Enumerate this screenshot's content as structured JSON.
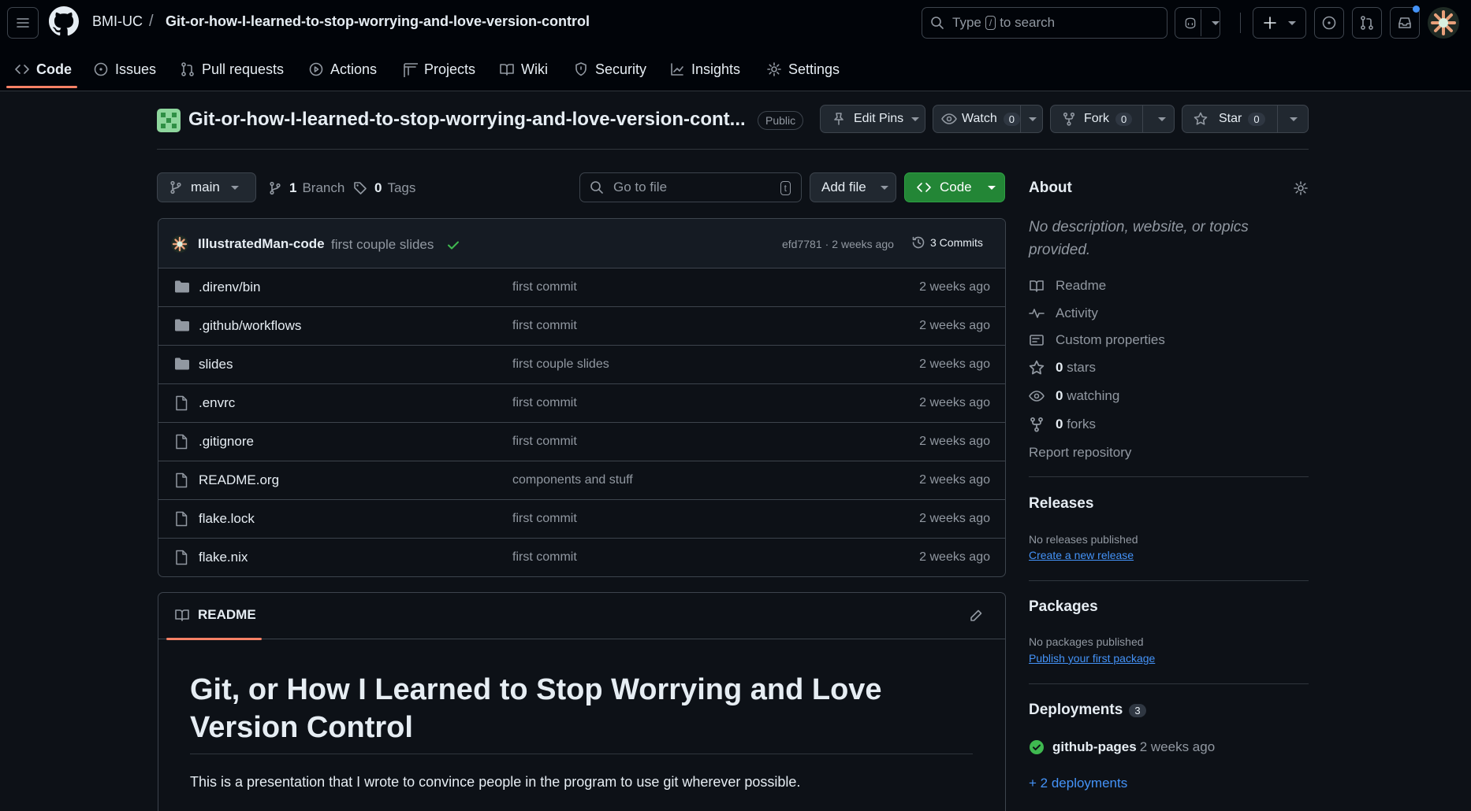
{
  "header": {
    "owner": "BMI-UC",
    "separator": "/",
    "repo": "Git-or-how-I-learned-to-stop-worrying-and-love-version-control",
    "search_prefix": "Type",
    "search_key": "/",
    "search_suffix": "to search"
  },
  "tabs": [
    {
      "label": "Code",
      "icon": "code-icon"
    },
    {
      "label": "Issues",
      "icon": "issue-icon"
    },
    {
      "label": "Pull requests",
      "icon": "pull-request-icon"
    },
    {
      "label": "Actions",
      "icon": "play-icon"
    },
    {
      "label": "Projects",
      "icon": "table-icon"
    },
    {
      "label": "Wiki",
      "icon": "book-icon"
    },
    {
      "label": "Security",
      "icon": "shield-icon"
    },
    {
      "label": "Insights",
      "icon": "graph-icon"
    },
    {
      "label": "Settings",
      "icon": "gear-icon"
    }
  ],
  "repo_header": {
    "title": "Git-or-how-I-learned-to-stop-worrying-and-love-version-cont...",
    "visibility": "Public",
    "edit_pins": "Edit Pins",
    "watch": "Watch",
    "watch_count": "0",
    "fork": "Fork",
    "fork_count": "0",
    "star": "Star",
    "star_count": "0"
  },
  "toolbar": {
    "branch": "main",
    "branches_count": "1",
    "branches_label": "Branch",
    "tags_count": "0",
    "tags_label": "Tags",
    "goto_placeholder": "Go to file",
    "goto_key": "t",
    "add_file": "Add file",
    "code": "Code"
  },
  "latest_commit": {
    "author": "IllustratedMan-code",
    "message": "first couple slides",
    "hash": "efd7781",
    "dot": "·",
    "when": "2 weeks ago",
    "commits": "3 Commits"
  },
  "files": [
    {
      "name": ".direnv/bin",
      "type": "folder",
      "message": "first commit",
      "date": "2 weeks ago"
    },
    {
      "name": ".github/workflows",
      "type": "folder",
      "message": "first commit",
      "date": "2 weeks ago"
    },
    {
      "name": "slides",
      "type": "folder",
      "message": "first couple slides",
      "date": "2 weeks ago"
    },
    {
      "name": ".envrc",
      "type": "file",
      "message": "first commit",
      "date": "2 weeks ago"
    },
    {
      "name": ".gitignore",
      "type": "file",
      "message": "first commit",
      "date": "2 weeks ago"
    },
    {
      "name": "README.org",
      "type": "file",
      "message": "components and stuff",
      "date": "2 weeks ago"
    },
    {
      "name": "flake.lock",
      "type": "file",
      "message": "first commit",
      "date": "2 weeks ago"
    },
    {
      "name": "flake.nix",
      "type": "file",
      "message": "first commit",
      "date": "2 weeks ago"
    }
  ],
  "readme": {
    "tab": "README",
    "heading": "Git, or How I Learned to Stop Worrying and Love Version Control",
    "paragraph": "This is a presentation that I wrote to convince people in the program to use git wherever possible."
  },
  "about": {
    "title": "About",
    "description": "No description, website, or topics provided.",
    "readme": "Readme",
    "activity": "Activity",
    "custom_properties": "Custom properties",
    "stars_count": "0",
    "stars_label": "stars",
    "watching_count": "0",
    "watching_label": "watching",
    "forks_count": "0",
    "forks_label": "forks",
    "report": "Report repository"
  },
  "releases": {
    "title": "Releases",
    "empty": "No releases published",
    "link": "Create a new release"
  },
  "packages": {
    "title": "Packages",
    "empty": "No packages published",
    "link": "Publish your first package"
  },
  "deployments": {
    "title": "Deployments",
    "count": "3",
    "env": "github-pages",
    "when": "2 weeks ago",
    "more": "+ 2 deployments"
  },
  "colors": {
    "accent": "#f78166",
    "primary_button": "#238636",
    "link": "#4493f8",
    "success": "#3fb950"
  }
}
